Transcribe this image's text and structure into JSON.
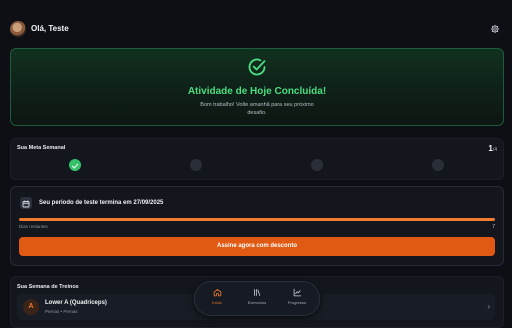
{
  "header": {
    "greeting": "Olá, Teste"
  },
  "hero": {
    "title": "Atividade de Hoje Concluída!",
    "subtitle": "Bom trabalho! Volte amanhã para seu próximo desafio."
  },
  "weekly_goal": {
    "title": "Sua Meta Semanal",
    "done": "1",
    "total": "/4",
    "days": [
      {
        "completed": true
      },
      {
        "completed": false
      },
      {
        "completed": false
      },
      {
        "completed": false
      }
    ]
  },
  "trial": {
    "title": "Seu período de teste termina em 27/09/2025",
    "days_label": "Dias restantes",
    "days_value": "7",
    "progress": 1.0,
    "cta_label": "Assine agora com desconto"
  },
  "week": {
    "title": "Sua Semana de Treinos",
    "workouts": [
      {
        "badge": "A",
        "name": "Lower A (Quadríceps)",
        "tags": "Pernas • Pernas"
      }
    ]
  },
  "nav": {
    "items": [
      {
        "label": "Início",
        "icon": "home-icon",
        "active": true
      },
      {
        "label": "Exercícios",
        "icon": "library-icon",
        "active": false
      },
      {
        "label": "Progresso",
        "icon": "chart-icon",
        "active": false
      }
    ]
  },
  "colors": {
    "accent": "#f07a2e",
    "success": "#4ade80",
    "background": "#0d0f14"
  }
}
